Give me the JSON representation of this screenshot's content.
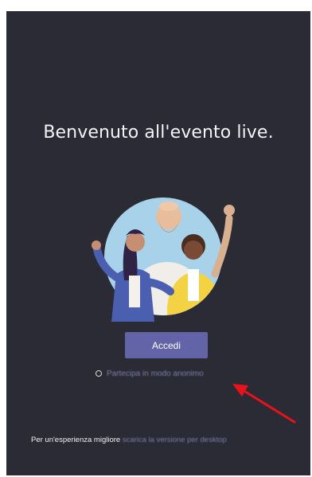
{
  "welcome": {
    "title": "Benvenuto all'evento live."
  },
  "actions": {
    "signin_label": "Accedi",
    "anonymous_label": "Partecipa in modo anonimo"
  },
  "footer": {
    "prefix": "Per un'esperienza migliore",
    "link": "scarica la versione per desktop"
  },
  "colors": {
    "background": "#2b2b35",
    "accent": "#6264a7",
    "link": "#7b7ea9",
    "annotation_arrow": "#e8121b"
  },
  "icons": {
    "anonymous_option": "radio-icon",
    "annotation": "red-arrow-icon"
  }
}
